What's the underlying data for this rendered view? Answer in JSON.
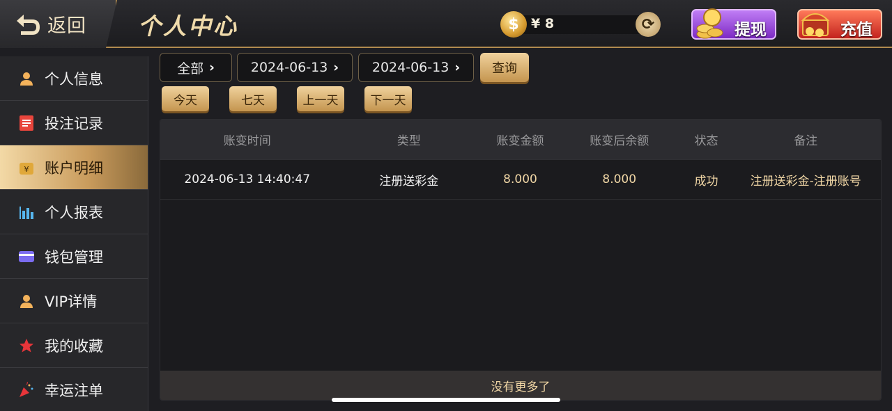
{
  "header": {
    "back_label": "返回",
    "title": "个人中心",
    "balance": "¥ 8",
    "withdraw_label": "提现",
    "deposit_label": "充值"
  },
  "sidebar": {
    "items": [
      {
        "label": "个人信息",
        "icon": "user-icon"
      },
      {
        "label": "投注记录",
        "icon": "record-icon"
      },
      {
        "label": "账户明细",
        "icon": "wallet-yen-icon",
        "active": true
      },
      {
        "label": "个人报表",
        "icon": "bar-chart-icon"
      },
      {
        "label": "钱包管理",
        "icon": "card-icon"
      },
      {
        "label": "VIP详情",
        "icon": "vip-user-icon"
      },
      {
        "label": "我的收藏",
        "icon": "star-icon"
      },
      {
        "label": "幸运注单",
        "icon": "party-icon"
      }
    ]
  },
  "filters": {
    "type": "全部",
    "start_date": "2024-06-13",
    "end_date": "2024-06-13",
    "query_label": "查询",
    "quick": [
      "今天",
      "七天",
      "上一天",
      "下一天"
    ]
  },
  "table": {
    "headers": [
      "账变时间",
      "类型",
      "账变金额",
      "账变后余额",
      "状态",
      "备注"
    ],
    "rows": [
      [
        "2024-06-13 14:40:47",
        "注册送彩金",
        "8.000",
        "8.000",
        "成功",
        "注册送彩金-注册账号"
      ]
    ],
    "footer": "没有更多了"
  },
  "colors": {
    "accent_gold": "#c99b5c",
    "withdraw": "#9b4fe0",
    "deposit": "#e0432f"
  }
}
